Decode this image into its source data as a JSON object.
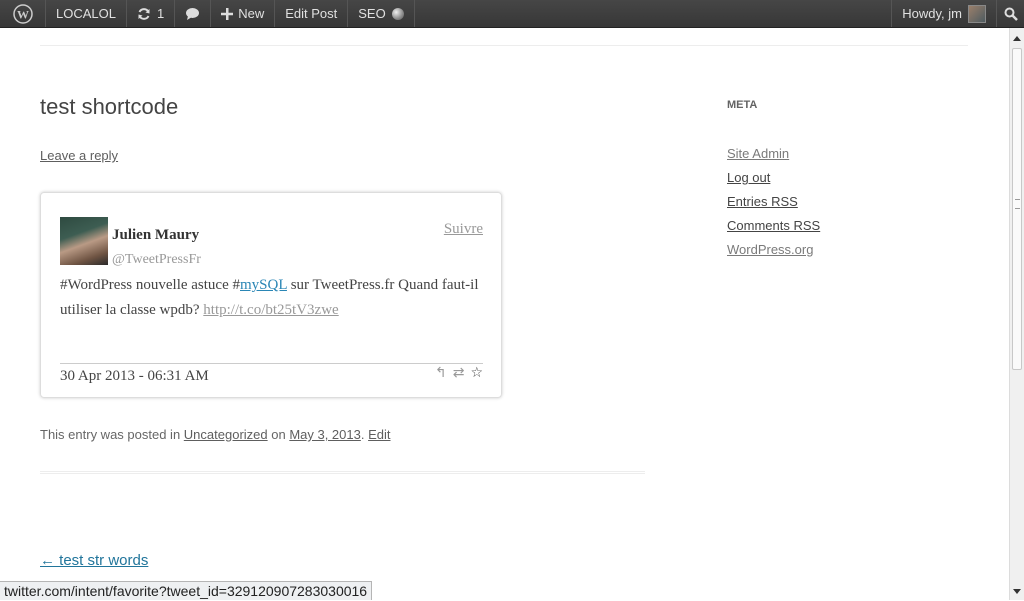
{
  "adminbar": {
    "site_name": "LOCALOL",
    "updates_icon": "refresh-icon",
    "updates_count": "1",
    "comments_icon": "speech-bubble-icon",
    "new_icon": "plus-icon",
    "new_label": "New",
    "edit_post_label": "Edit Post",
    "seo_label": "SEO",
    "howdy_label": "Howdy, jm",
    "search_icon": "magnifier-icon"
  },
  "post": {
    "title": "test shortcode",
    "leave_reply": "Leave a reply",
    "meta_prefix": "This entry was posted in ",
    "category": "Uncategorized",
    "on_word": " on ",
    "date": "May 3, 2013",
    "period": ". ",
    "edit_label": "Edit"
  },
  "tweet": {
    "name": "Julien Maury",
    "handle": "@TweetPressFr",
    "follow_label": "Suivre",
    "text_before_tag": "#WordPress nouvelle astuce #",
    "tag": "mySQL",
    "text_after_tag": " sur TweetPress.fr Quand faut-il utiliser la classe wpdb? ",
    "link": "http://t.co/bt25tV3zwe",
    "timestamp": "30 Apr 2013 - 06:31 AM",
    "actions": [
      "reply-icon",
      "retweet-icon",
      "favorite-icon"
    ]
  },
  "navigation": {
    "previous": "← test str words"
  },
  "sidebar": {
    "title": "META",
    "items": [
      {
        "label": "Site Admin"
      },
      {
        "label": "Log out"
      },
      {
        "label": "Entries RSS"
      },
      {
        "label": "Comments RSS"
      },
      {
        "label": "WordPress.org"
      }
    ]
  },
  "statusbar": {
    "url": "twitter.com/intent/favorite?tweet_id=329120907283030016"
  }
}
